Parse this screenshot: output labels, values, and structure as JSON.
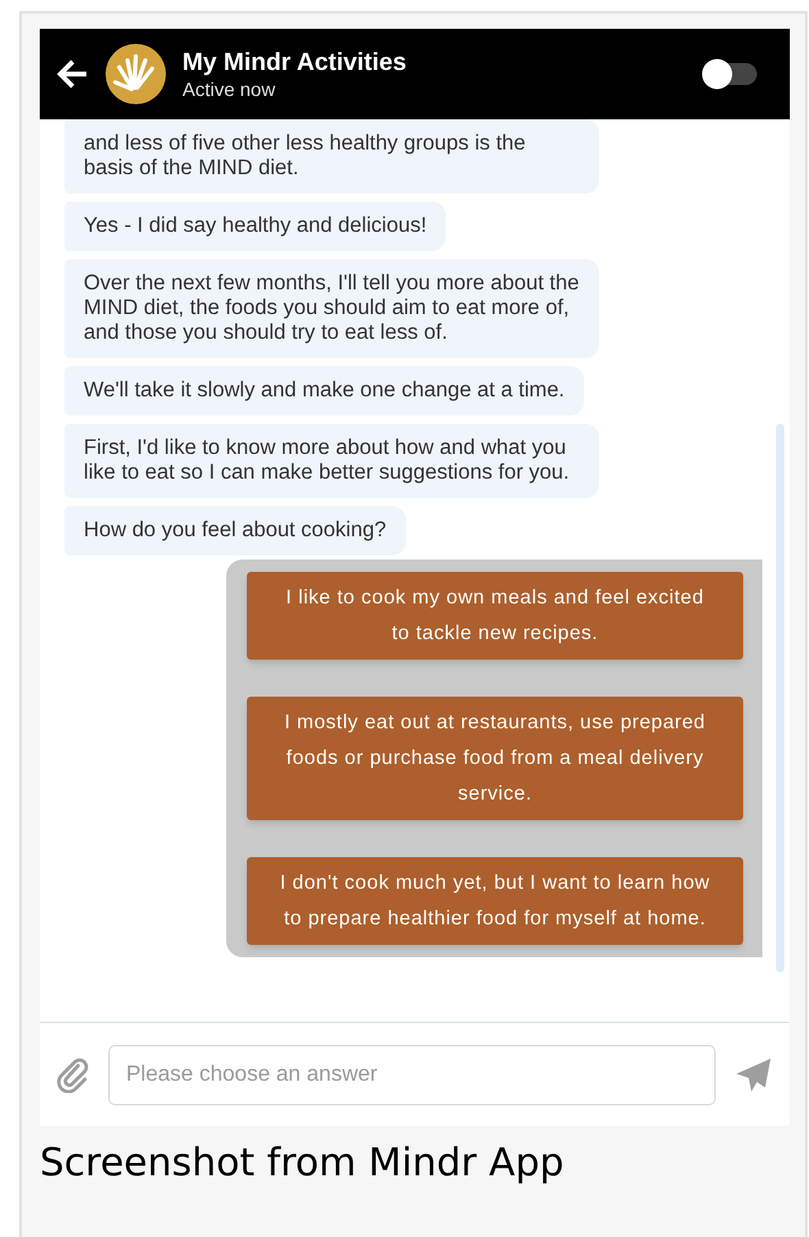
{
  "header": {
    "title": "My Mindr Activities",
    "status": "Active now",
    "toggle": {
      "on": false
    }
  },
  "messages": [
    {
      "text": "and less of five other less healthy groups is the basis of the MIND diet."
    },
    {
      "text": "Yes - I did say healthy and delicious!"
    },
    {
      "text": "Over the next few months, I'll tell you more about the MIND diet, the foods you should aim to eat more of, and those you should try to eat less of."
    },
    {
      "text": "We'll take it slowly and make one change at a time."
    },
    {
      "text": "First, I'd like to know more about how and what you like to eat so I can make better suggestions for you."
    },
    {
      "text": "How do you feel about cooking?"
    }
  ],
  "answers": [
    "I like to cook my own meals and feel excited to tackle new recipes.",
    "I mostly eat out at restaurants, use prepared foods or purchase food from a meal delivery service.",
    "I don't cook much yet, but I want to learn how to prepare healthier food for myself at home."
  ],
  "composer": {
    "placeholder": "Please choose an answer"
  },
  "caption": "Screenshot from Mindr App"
}
